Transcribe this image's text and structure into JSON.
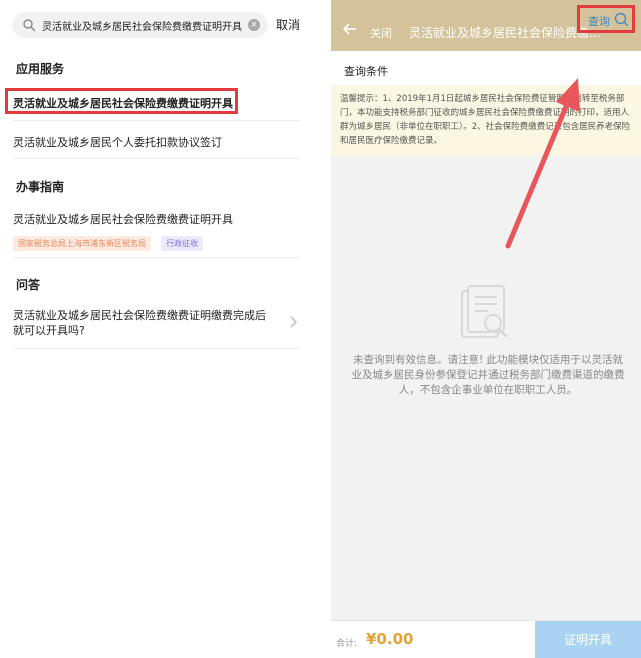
{
  "left": {
    "search": {
      "value": "灵活就业及城乡居民社会保险费缴费证明开具",
      "clear": "×"
    },
    "cancel_label": "取消",
    "sections": {
      "apps": "应用服务",
      "guide": "办事指南",
      "qa": "问答"
    },
    "app_items": [
      "灵活就业及城乡居民社会保险费缴费证明开具",
      "灵活就业及城乡居民个人委托扣款协议签订"
    ],
    "guide_item": {
      "title": "灵活就业及城乡居民社会保险费缴费证明开具",
      "tags": [
        "国家税务总局上海市浦东新区税务局",
        "行政征收"
      ]
    },
    "qa_item": "灵活就业及城乡居民社会保险费缴费证明缴费完成后就可以开具吗?"
  },
  "right": {
    "header": {
      "close_label": "关闭",
      "title": "灵活就业及城乡居民社会保险费缴..."
    },
    "conditions_label": "查询条件",
    "query_label": "查询",
    "notice": "温馨提示：1、2019年1月1日起城乡居民社会保险费征管职责划转至税务部门，本功能支持税务部门征收的城乡居民社会保险费缴费证明的打印，适用人群为城乡居民（非单位在职职工）。2、社会保险费缴费记录包含居民养老保险和居民医疗保险缴费记录。",
    "empty_message": "未查询到有效信息。请注意! 此功能模块仅适用于以灵活就业及城乡居民身份参保登记并通过税务部门缴费渠道的缴费人，不包含企事业单位在职职工人员。",
    "footer": {
      "total_label": "合计:",
      "total_value": "¥0.00",
      "issue_button": "证明开具"
    }
  },
  "colors": {
    "header_bg": "#d3c29a",
    "highlight": "#e23b3b",
    "link": "#3b88c9",
    "amount": "#e0a53a",
    "button_disabled": "#a9d3f0",
    "notice_bg": "#fcf7e3"
  }
}
